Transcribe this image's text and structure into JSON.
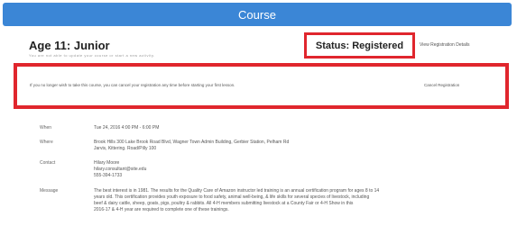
{
  "header": {
    "title": "Course"
  },
  "course": {
    "title": "Age 11: Junior",
    "subtitle": "You are not able to update your course or start a new activity."
  },
  "status": {
    "label": "Status: Registered"
  },
  "top_link": {
    "label": "View Registration Details"
  },
  "cancel_panel": {
    "message": "If you no longer wish to take this course, you can cancel your registration any time before starting your first lesson.",
    "link": "Cancel Registration"
  },
  "details": {
    "when": {
      "label": "When",
      "value": "Tue 24, 2016 4:00 PM - 6:00 PM"
    },
    "where": {
      "label": "Where",
      "line1": "Brook Hills 300 Lake Brook Road Blvd, Wagner Town Admin Building, Gerbier Station, Pelham Rd",
      "line2": "Jarvis, Kittering. Road/Pilly 100"
    },
    "contact": {
      "label": "Contact",
      "line1": "Hilary Moore",
      "line2": "hilary.consultant@site.edu",
      "line3": "555-394-1733"
    },
    "message": {
      "label": "Message",
      "line1": "The best interest is in 1981. The results for the Quality Care of Amazon instructor led training is an annual certification program for ages 8 to 14",
      "line2": "years old. This certification provides youth exposure to food safety, animal well-being, & life skills for several species of livestock, including",
      "line3": "beef & dairy cattle, sheep, goats, pigs, poultry & rabbits. All 4-H members submitting livestock at a County Fair or 4-H Show in this",
      "line4": "2016-17 & 4-H year are required to complete one of these trainings."
    }
  }
}
